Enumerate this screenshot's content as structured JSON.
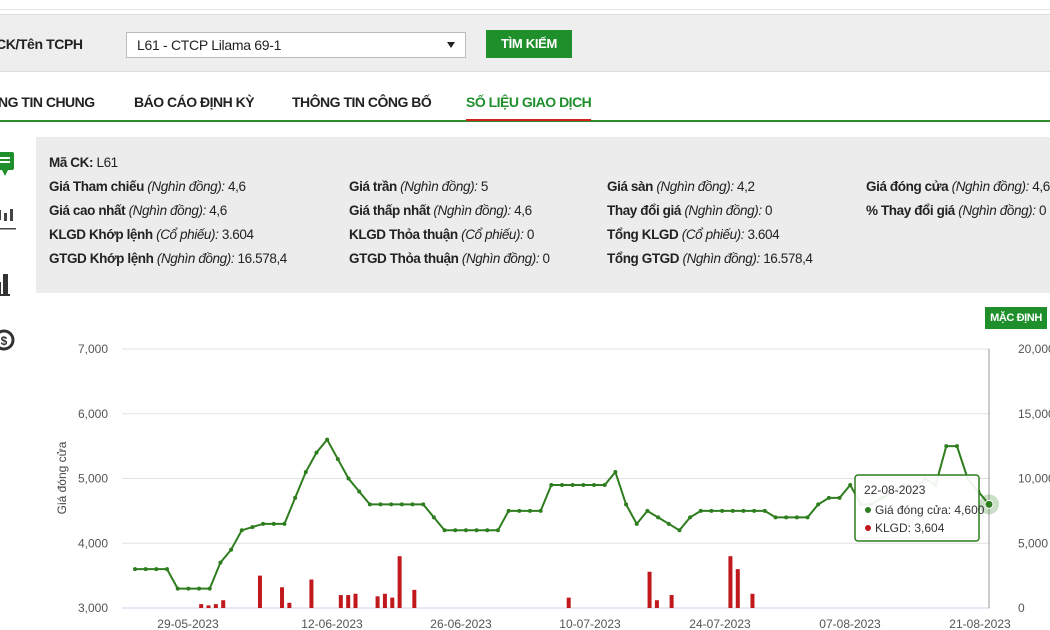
{
  "search": {
    "label": "CK/Tên TCPH",
    "selected": "L61 - CTCP Lilama 69-1",
    "button": "TÌM KIẾM"
  },
  "tabs": [
    {
      "label": "NG TIN CHUNG"
    },
    {
      "label": "BÁO CÁO ĐỊNH KỲ"
    },
    {
      "label": "THÔNG TIN CÔNG BỐ"
    },
    {
      "label": "SỐ LIỆU GIAO DỊCH"
    }
  ],
  "info": {
    "ma_ck": {
      "k": "Mã CK:",
      "v": " L61"
    },
    "rows": [
      [
        {
          "k": "Giá Tham chiếu",
          "u": " (Nghìn đồng):",
          "v": " 4,6"
        },
        {
          "k": "Giá trần",
          "u": " (Nghìn đồng):",
          "v": " 5"
        },
        {
          "k": "Giá sàn",
          "u": " (Nghìn đồng):",
          "v": " 4,2"
        },
        {
          "k": "Giá đóng cửa",
          "u": " (Nghìn đồng):",
          "v": " 4,6"
        }
      ],
      [
        {
          "k": "Giá cao nhất",
          "u": " (Nghìn đồng):",
          "v": " 4,6"
        },
        {
          "k": "Giá thấp nhất",
          "u": " (Nghìn đồng):",
          "v": " 4,6"
        },
        {
          "k": "Thay đổi giá",
          "u": " (Nghìn đồng):",
          "v": " 0"
        },
        {
          "k": "% Thay đổi giá",
          "u": " (Nghìn đồng):",
          "v": " 0"
        }
      ],
      [
        {
          "k": "KLGD Khớp lệnh",
          "u": " (Cổ phiếu):",
          "v": " 3.604"
        },
        {
          "k": "KLGD Thỏa thuận",
          "u": " (Cổ phiếu):",
          "v": " 0"
        },
        {
          "k": "Tổng KLGD",
          "u": " (Cổ phiếu):",
          "v": " 3.604"
        }
      ],
      [
        {
          "k": "GTGD Khớp lệnh",
          "u": " (Nghìn đồng):",
          "v": " 16.578,4"
        },
        {
          "k": "GTGD Thỏa thuận",
          "u": " (Nghìn đồng):",
          "v": " 0"
        },
        {
          "k": "Tổng GTGD",
          "u": " (Nghìn đồng):",
          "v": " 16.578,4"
        }
      ]
    ]
  },
  "chart": {
    "default_button": "MẶC ĐỊNH",
    "tooltip": {
      "date": "22-08-2023",
      "close": "Giá đóng cửa: 4,600",
      "volume": "KLGD: 3,604"
    }
  },
  "chart_data": {
    "type": "line",
    "ylabel": "Giá đóng cửa",
    "ylim": [
      3000,
      7000
    ],
    "y2lim": [
      0,
      20000
    ],
    "yticks": [
      "7,000",
      "6,000",
      "5,000",
      "4,000",
      "3,000"
    ],
    "y2ticks": [
      "20,000",
      "15,000",
      "10,000",
      "5,000",
      "0"
    ],
    "xticks": [
      "29-05-2023",
      "12-06-2023",
      "26-06-2023",
      "10-07-2023",
      "24-07-2023",
      "07-08-2023",
      "21-08-2023"
    ],
    "series": [
      {
        "kind": "line",
        "color": "#2e7d1e",
        "values": [
          3600,
          3600,
          3600,
          3600,
          3300,
          3300,
          3300,
          3300,
          3700,
          3900,
          4200,
          4250,
          4300,
          4300,
          4300,
          4700,
          5100,
          5400,
          5600,
          5300,
          5000,
          4800,
          4600,
          4600,
          4600,
          4600,
          4600,
          4600,
          4400,
          4200,
          4200,
          4200,
          4200,
          4200,
          4200,
          4500,
          4500,
          4500,
          4500,
          4900,
          4900,
          4900,
          4900,
          4900,
          4900,
          5100,
          4600,
          4300,
          4500,
          4400,
          4300,
          4200,
          4400,
          4500,
          4500,
          4500,
          4500,
          4500,
          4500,
          4500,
          4400,
          4400,
          4400,
          4400,
          4600,
          4700,
          4700,
          4900,
          4600,
          4600,
          4700,
          4800,
          4900,
          4800,
          5000,
          4900,
          5500,
          5500,
          5000,
          4800,
          4600
        ]
      },
      {
        "kind": "bar",
        "color": "#c0181c",
        "values": [
          0,
          0,
          0,
          0,
          0,
          0,
          0,
          0,
          0,
          300,
          200,
          300,
          600,
          0,
          0,
          0,
          0,
          2500,
          0,
          0,
          1600,
          400,
          0,
          0,
          2200,
          0,
          0,
          0,
          1000,
          1000,
          1100,
          0,
          0,
          900,
          1100,
          800,
          4000,
          0,
          1400,
          0,
          0,
          0,
          0,
          0,
          0,
          0,
          0,
          0,
          0,
          0,
          0,
          0,
          0,
          0,
          0,
          0,
          0,
          0,
          0,
          800,
          0,
          0,
          0,
          0,
          0,
          0,
          0,
          0,
          0,
          0,
          2800,
          600,
          0,
          1000,
          0,
          0,
          0,
          0,
          0,
          0,
          0,
          4000,
          3000,
          0,
          1100,
          0,
          0,
          0,
          0,
          0,
          0,
          0,
          0,
          0,
          0,
          0,
          0,
          0,
          0,
          0,
          0,
          0,
          0,
          0,
          0,
          0,
          0,
          0,
          0,
          0,
          0,
          0,
          0,
          0,
          0
        ]
      }
    ]
  }
}
